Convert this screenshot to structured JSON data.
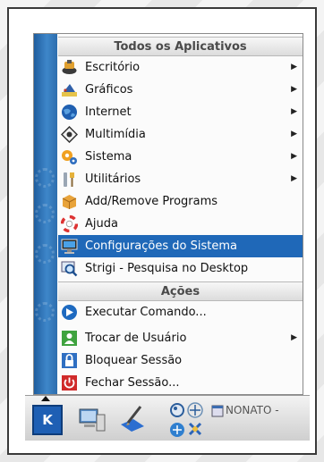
{
  "menu": {
    "header_all": "Todos os Aplicativos",
    "header_actions": "Ações",
    "items": [
      {
        "label": "Escritório",
        "icon": "office-icon",
        "submenu": true
      },
      {
        "label": "Gráficos",
        "icon": "graphics-icon",
        "submenu": true
      },
      {
        "label": "Internet",
        "icon": "internet-globe-icon",
        "submenu": true
      },
      {
        "label": "Multimídia",
        "icon": "multimedia-icon",
        "submenu": true
      },
      {
        "label": "Sistema",
        "icon": "system-icon",
        "submenu": true
      },
      {
        "label": "Utilitários",
        "icon": "utilities-icon",
        "submenu": true
      },
      {
        "label": "Add/Remove Programs",
        "icon": "package-icon",
        "submenu": false
      },
      {
        "label": "Ajuda",
        "icon": "help-lifebuoy-icon",
        "submenu": false
      },
      {
        "label": "Configurações do Sistema",
        "icon": "settings-monitor-icon",
        "submenu": false,
        "selected": true
      },
      {
        "label": "Strigi - Pesquisa no Desktop",
        "icon": "search-magnifier-icon",
        "submenu": false
      }
    ],
    "actions": [
      {
        "label": "Executar Comando...",
        "icon": "run-command-icon",
        "submenu": false
      },
      {
        "label": "Trocar de Usuário",
        "icon": "switch-user-icon",
        "submenu": true
      },
      {
        "label": "Bloquear Sessão",
        "icon": "lock-icon",
        "submenu": false
      },
      {
        "label": "Fechar Sessão...",
        "icon": "logout-power-icon",
        "submenu": false
      }
    ],
    "submenu_arrow": "▶"
  },
  "taskbar": {
    "kmenu_label": "K",
    "task_label": "NONATO -"
  },
  "colors": {
    "selection": "#1f68b8",
    "side_strip": "#2d6eae"
  }
}
